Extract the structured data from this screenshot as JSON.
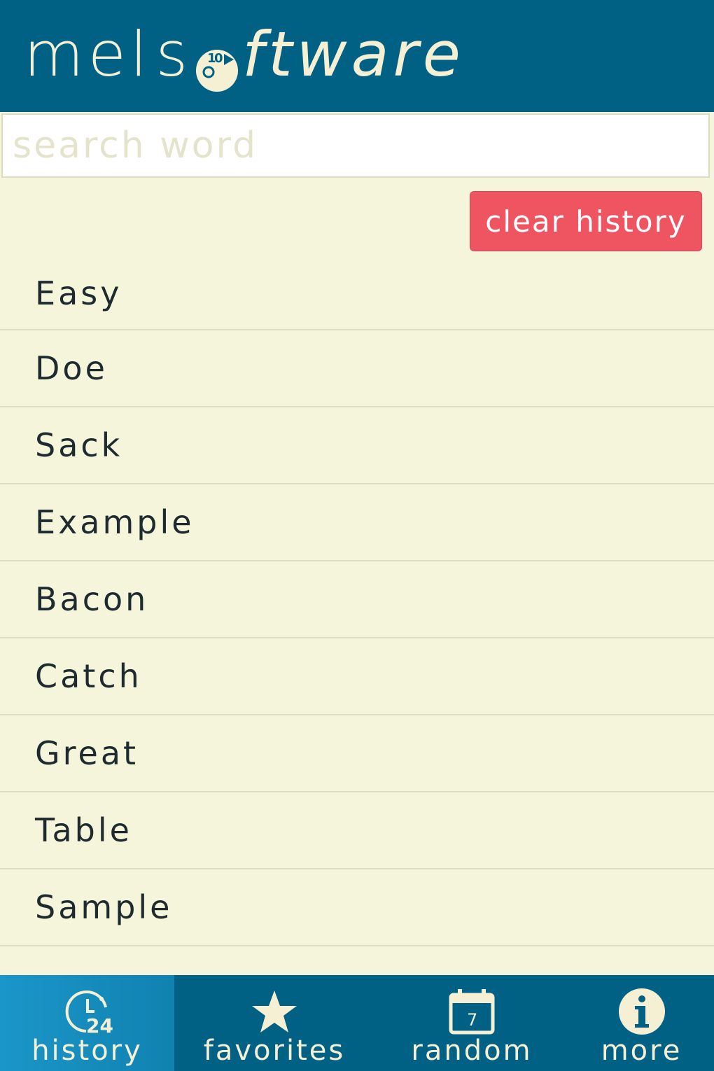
{
  "header": {
    "logo_left": "mel",
    "logo_right": "ftware",
    "logo_s": "s"
  },
  "search": {
    "placeholder": "search word",
    "value": ""
  },
  "clear_history_label": "clear history",
  "history_items": [
    {
      "label": "Easy"
    },
    {
      "label": "Doe"
    },
    {
      "label": "Sack"
    },
    {
      "label": "Example"
    },
    {
      "label": "Bacon"
    },
    {
      "label": "Catch"
    },
    {
      "label": "Great"
    },
    {
      "label": "Table"
    },
    {
      "label": "Sample"
    }
  ],
  "tabs": [
    {
      "label": "history",
      "icon": "clock-24-icon",
      "active": true,
      "badge": "24"
    },
    {
      "label": "favorites",
      "icon": "star-icon",
      "active": false
    },
    {
      "label": "random",
      "icon": "calendar-icon",
      "active": false,
      "badge": "7"
    },
    {
      "label": "more",
      "icon": "info-icon",
      "active": false
    }
  ],
  "colors": {
    "header_bg": "#016185",
    "background": "#f5f5dc",
    "accent_button": "#ef5561",
    "active_tab": "#1b96c8",
    "text_light": "#f5f0d4"
  }
}
